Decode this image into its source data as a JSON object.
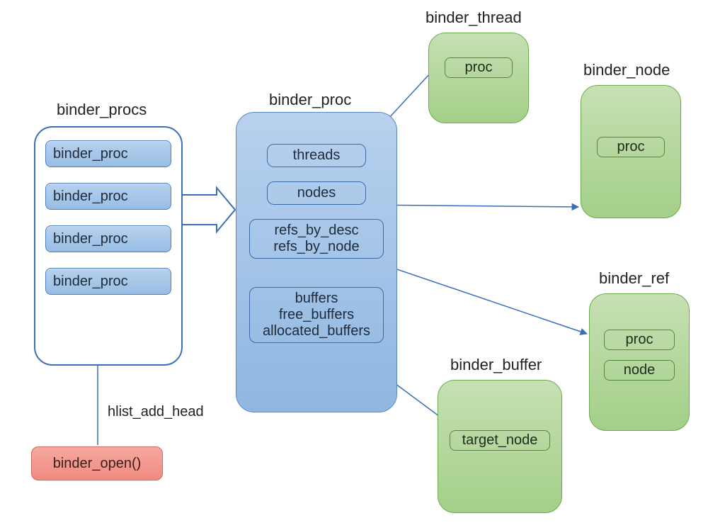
{
  "titles": {
    "binder_procs": "binder_procs",
    "binder_proc": "binder_proc",
    "binder_thread": "binder_thread",
    "binder_node": "binder_node",
    "binder_buffer": "binder_buffer",
    "binder_ref": "binder_ref"
  },
  "procs_list": {
    "items": [
      "binder_proc",
      "binder_proc",
      "binder_proc",
      "binder_proc"
    ]
  },
  "proc_fields": {
    "threads": "threads",
    "nodes": "nodes",
    "refs_by_desc": "refs_by_desc",
    "refs_by_node": "refs_by_node",
    "buffers": "buffers",
    "free_buffers": "free_buffers",
    "allocated_buffers": "allocated_buffers"
  },
  "thread_fields": {
    "proc": "proc"
  },
  "node_fields": {
    "proc": "proc"
  },
  "ref_fields": {
    "proc": "proc",
    "node": "node"
  },
  "buffer_fields": {
    "target_node": "target_node"
  },
  "binder_open": {
    "label": "binder_open()",
    "edge_label": "hlist_add_head"
  },
  "colors": {
    "blue_fill_top": "#b8d1ee",
    "blue_fill_bottom": "#97bde4",
    "blue_border": "#4f80bc",
    "green_fill_top": "#c6e0b3",
    "green_fill_bottom": "#a3cf88",
    "green_border": "#6aab4f",
    "red_fill_top": "#f6a9a1",
    "red_fill_bottom": "#f08a7f",
    "red_border": "#cf6a60",
    "arrow": "#3a6fb7"
  }
}
